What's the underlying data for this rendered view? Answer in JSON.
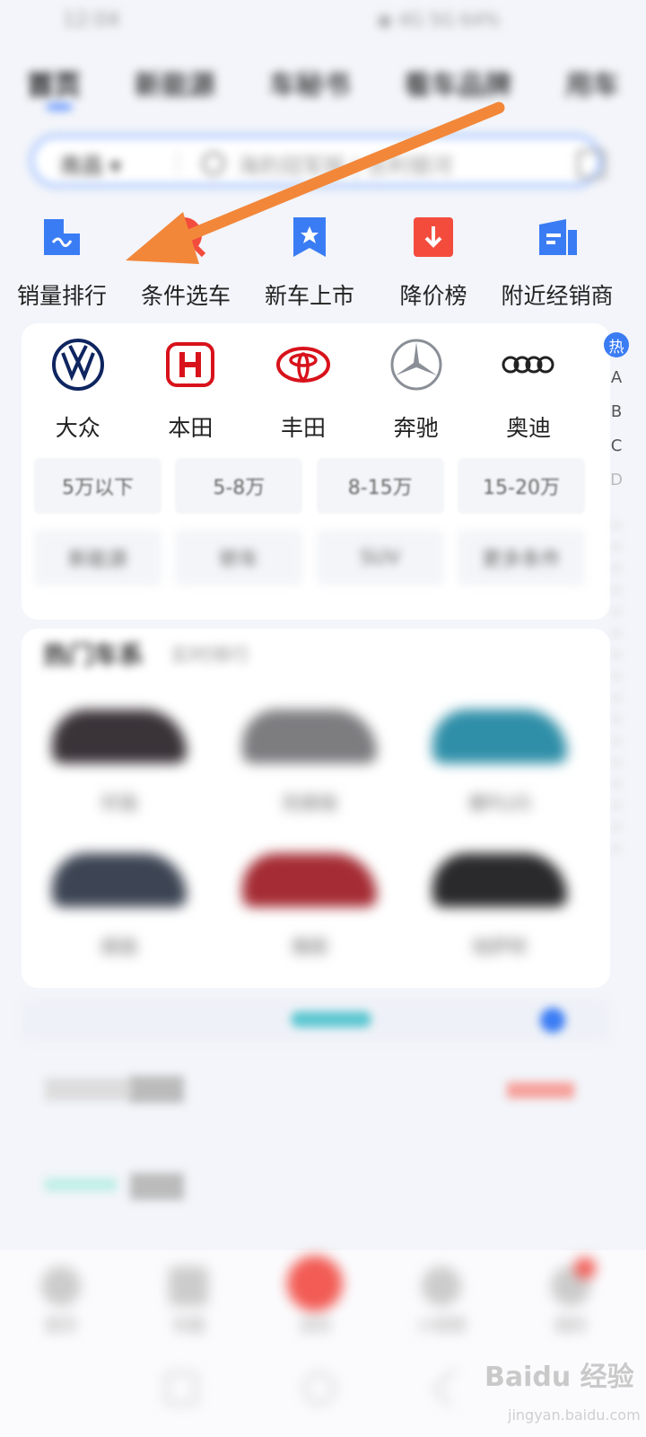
{
  "status": {
    "time": "12:04",
    "right": "◉ 4G 5G 64%"
  },
  "top_tabs": [
    "首页",
    "新能源",
    "车秘书",
    "看车品牌",
    "用车"
  ],
  "search": {
    "city": "南昌 ▾",
    "placeholder": "海豹冠军版 | 吉利银河"
  },
  "quick_actions": [
    {
      "label": "销量排行",
      "icon": "chart-icon"
    },
    {
      "label": "条件选车",
      "icon": "filter-icon"
    },
    {
      "label": "新车上市",
      "icon": "new-car-icon"
    },
    {
      "label": "降价榜",
      "icon": "price-drop-icon"
    },
    {
      "label": "附近经销商",
      "icon": "dealer-icon"
    }
  ],
  "brands": [
    {
      "name": "大众",
      "logo": "volkswagen-logo"
    },
    {
      "name": "本田",
      "logo": "honda-logo"
    },
    {
      "name": "丰田",
      "logo": "toyota-logo"
    },
    {
      "name": "奔驰",
      "logo": "mercedes-logo"
    },
    {
      "name": "奥迪",
      "logo": "audi-logo"
    }
  ],
  "price_filters": [
    "5万以下",
    "5-8万",
    "8-15万",
    "15-20万"
  ],
  "type_filters": [
    "新能源",
    "轿车",
    "SUV",
    "更多条件"
  ],
  "index": {
    "hot": "热",
    "letters": [
      "A",
      "B",
      "C",
      "D"
    ]
  },
  "hot_section": {
    "title": "热门车系",
    "subtitle": "实时排行",
    "cars": [
      "轩逸",
      "凯美瑞",
      "秦PLUS",
      "朗逸",
      "雅阁",
      "帕萨特"
    ]
  },
  "bottom_nav": [
    "首页",
    "车圈",
    "选车",
    "小视频",
    "我的"
  ],
  "watermark": {
    "brand": "Baidu 经验",
    "url": "jingyan.baidu.com"
  },
  "colors": {
    "accent": "#3a7cf4",
    "red": "#f34c3d",
    "arrow": "#f2873a"
  }
}
